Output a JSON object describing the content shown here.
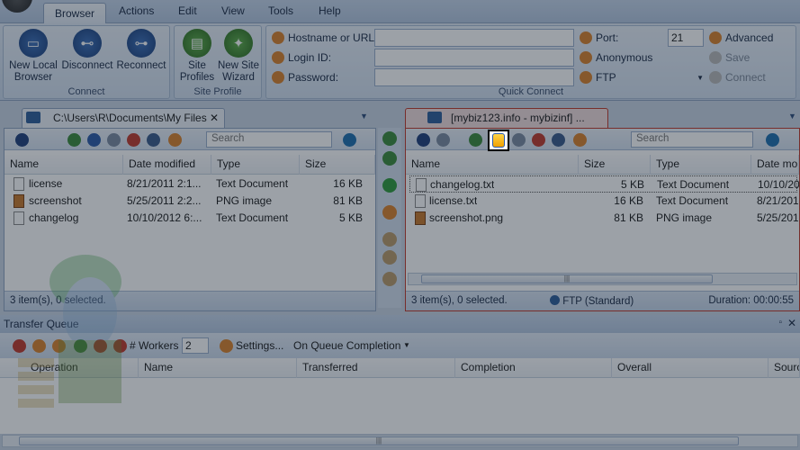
{
  "menu": {
    "tabs": [
      "Browser",
      "Actions",
      "Edit",
      "View",
      "Tools",
      "Help"
    ],
    "active": "Browser"
  },
  "ribbon": {
    "connect_group": {
      "title": "Connect",
      "buttons": [
        {
          "label_line1": "New Local",
          "label_line2": "Browser"
        },
        {
          "label_line1": "Disconnect",
          "label_line2": ""
        },
        {
          "label_line1": "Reconnect",
          "label_line2": ""
        }
      ]
    },
    "site_profile_group": {
      "title": "Site Profile",
      "buttons": [
        {
          "label_line1": "Site",
          "label_line2": "Profiles"
        },
        {
          "label_line1": "New Site",
          "label_line2": "Wizard"
        }
      ]
    },
    "quick_connect": {
      "title": "Quick Connect",
      "hostname_label": "Hostname or URL:",
      "login_label": "Login ID:",
      "password_label": "Password:",
      "port_label": "Port:",
      "port_value": "21",
      "anonymous_label": "Anonymous",
      "protocol_value": "FTP",
      "advanced_label": "Advanced",
      "save_label": "Save",
      "connect_label": "Connect"
    }
  },
  "left_pane": {
    "tab_title": "C:\\Users\\R\\Documents\\My Files",
    "search_placeholder": "Search",
    "columns": [
      "Name",
      "Date modified",
      "Type",
      "Size"
    ],
    "rows": [
      {
        "name": "license",
        "date": "8/21/2011 2:1...",
        "type": "Text Document",
        "size": "16 KB",
        "icon": "text-file-icon"
      },
      {
        "name": "screenshot",
        "date": "5/25/2011 2:2...",
        "type": "PNG image",
        "size": "81 KB",
        "icon": "image-file-icon"
      },
      {
        "name": "changelog",
        "date": "10/10/2012 6:...",
        "type": "Text Document",
        "size": "5 KB",
        "icon": "text-file-icon"
      }
    ],
    "status": "3 item(s), 0 selected."
  },
  "right_pane": {
    "tab_title": "[mybiz123.info - mybizinf] ...",
    "search_placeholder": "Search",
    "columns": [
      "Name",
      "Size",
      "Type",
      "Date mo"
    ],
    "rows": [
      {
        "name": "changelog.txt",
        "size": "5 KB",
        "type": "Text Document",
        "date": "10/10/20",
        "icon": "text-file-icon"
      },
      {
        "name": "license.txt",
        "size": "16 KB",
        "type": "Text Document",
        "date": "8/21/201",
        "icon": "text-file-icon"
      },
      {
        "name": "screenshot.png",
        "size": "81 KB",
        "type": "PNG image",
        "date": "5/25/201",
        "icon": "image-file-icon"
      }
    ],
    "status": "3 item(s), 0 selected.",
    "protocol": "FTP (Standard)",
    "duration": "Duration: 00:00:55"
  },
  "queue": {
    "title": "Transfer Queue",
    "workers_label": "# Workers",
    "workers_value": "2",
    "settings_label": "Settings...",
    "completion_label": "On Queue Completion",
    "columns": [
      "Operation",
      "Name",
      "Transferred",
      "Completion",
      "Overall",
      "Sourc"
    ]
  },
  "colors": {
    "accent": "#c0392b",
    "ribbon": "#c7d6ea"
  }
}
